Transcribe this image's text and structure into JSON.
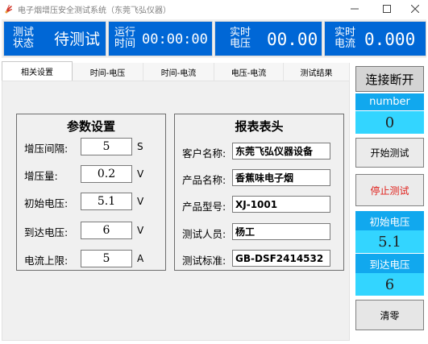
{
  "window": {
    "title": "电子烟增压安全测试系统（东莞飞弘仪器）",
    "buttons": [
      "minimize",
      "maximize",
      "close"
    ]
  },
  "status": {
    "test_state": {
      "label": "测试\n状态",
      "value": "待测试"
    },
    "run_time": {
      "label": "运行\n时间",
      "value": "00:00:00"
    },
    "voltage": {
      "label": "实时\n电压",
      "value": "00.00"
    },
    "current": {
      "label": "实时\n电流",
      "value": "0.000"
    }
  },
  "tabs": [
    "相关设置",
    "时间-电压",
    "时间-电流",
    "电压-电流",
    "测试结果"
  ],
  "active_tab": 0,
  "params": {
    "title": "参数设置",
    "rows": [
      {
        "label": "增压间隔:",
        "value": "5",
        "unit": "S"
      },
      {
        "label": "增压量:",
        "value": "0.2",
        "unit": "V"
      },
      {
        "label": "初始电压:",
        "value": "5.1",
        "unit": "V"
      },
      {
        "label": "到达电压:",
        "value": "6",
        "unit": "V"
      },
      {
        "label": "电流上限:",
        "value": "5",
        "unit": "A"
      }
    ]
  },
  "report": {
    "title": "报表表头",
    "rows": [
      {
        "label": "客户名称:",
        "value": "东莞飞弘仪器设备"
      },
      {
        "label": "产品名称:",
        "value": "香蕉味电子烟"
      },
      {
        "label": "产品型号:",
        "value": "XJ-1001"
      },
      {
        "label": "测试人员:",
        "value": "杨工"
      },
      {
        "label": "测试标准:",
        "value": "GB-DSF2414532"
      }
    ]
  },
  "right": {
    "connect_label": "连接断开",
    "number_label": "number",
    "number_value": "0",
    "start_label": "开始测试",
    "stop_label": "停止测试",
    "init_voltage_label": "初始电压",
    "init_voltage_value": "5.1",
    "reach_voltage_label": "到达电压",
    "reach_voltage_value": "6",
    "clear_label": "清零"
  },
  "colors": {
    "status_blue": "#0067d6",
    "label_blue": "#11a8ee",
    "value_cyan": "#33d5ff",
    "stop_red": "#e0201b"
  }
}
